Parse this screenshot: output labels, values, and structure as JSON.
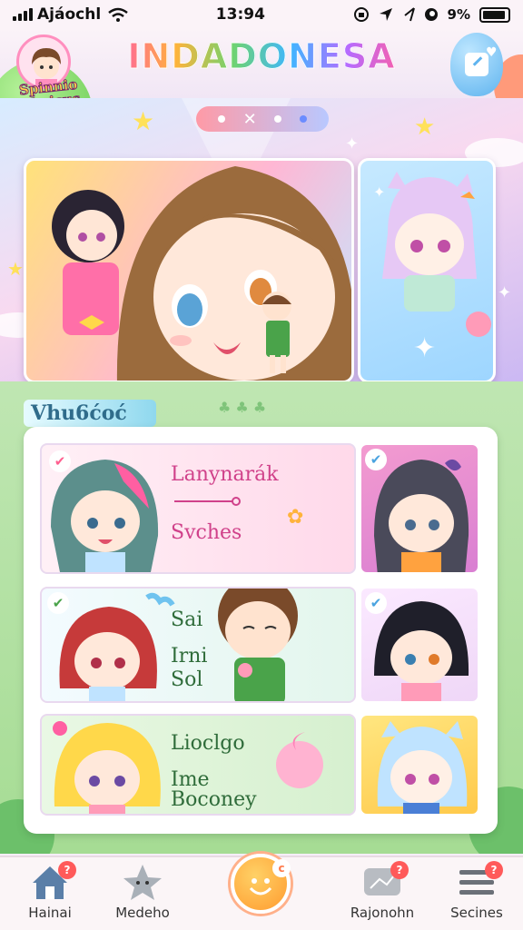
{
  "status_bar": {
    "carrier": "Ajáochl",
    "time": "13:94",
    "battery": "9%"
  },
  "header": {
    "title": "INDADONESA",
    "logo_text": "Spinnio Waricus"
  },
  "section": {
    "title": "Vhu6ćoć"
  },
  "rows": [
    {
      "line1": "Lanynarák",
      "line2": "Svches"
    },
    {
      "line1": "Sai",
      "line2": "Irni",
      "line3": "Sol"
    },
    {
      "line1": "Lioclgo",
      "line2": "Ime",
      "line3": "Boconey"
    }
  ],
  "nav": [
    {
      "label": "Hainai",
      "icon": "home-icon",
      "badge": "?"
    },
    {
      "label": "Medeho",
      "icon": "star-icon",
      "badge": ""
    },
    {
      "label": "",
      "icon": "smiley-icon",
      "badge": "c"
    },
    {
      "label": "Rajonohn",
      "icon": "chat-icon",
      "badge": "?"
    },
    {
      "label": "Secines",
      "icon": "menu-icon",
      "badge": "?"
    }
  ],
  "colors": {
    "accent": "#ff5fa2",
    "green": "#a6dc94",
    "blue": "#5fb4ef"
  }
}
